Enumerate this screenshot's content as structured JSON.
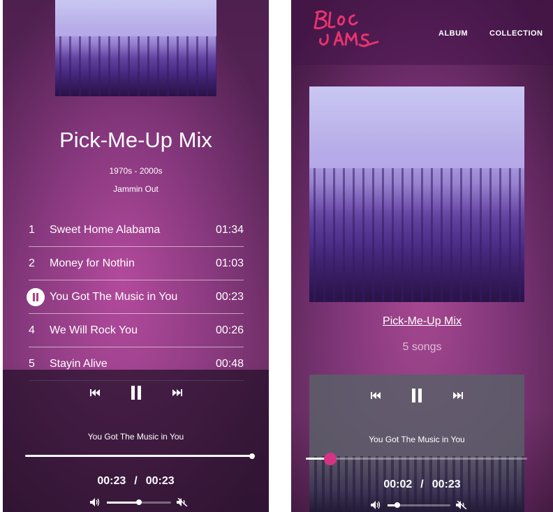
{
  "left": {
    "album": {
      "title": "Pick-Me-Up Mix",
      "years": "1970s - 2000s",
      "label": "Jammin Out"
    },
    "songs": [
      {
        "number": "1",
        "title": "Sweet Home Alabama",
        "duration": "01:34"
      },
      {
        "number": "2",
        "title": "Money for Nothin",
        "duration": "01:03"
      },
      {
        "number": "3",
        "title": "You Got The Music in You",
        "duration": "00:23",
        "playing": true
      },
      {
        "number": "4",
        "title": "We Will Rock You",
        "duration": "00:26"
      },
      {
        "number": "5",
        "title": "Stayin Alive",
        "duration": "00:48"
      }
    ],
    "player": {
      "now_playing": "You Got The Music in You",
      "current_time": "00:23",
      "separator": "/",
      "total_time": "00:23",
      "seek_progress": 1.0,
      "volume": 0.5
    }
  },
  "right": {
    "nav": {
      "logo_text": "Bloc Jams",
      "album_link": "ALBUM",
      "collection_link": "COLLECTION"
    },
    "album": {
      "title_link": "Pick-Me-Up Mix",
      "song_count": "5 songs"
    },
    "player": {
      "now_playing": "You Got The Music in You",
      "current_time": "00:02",
      "separator": "/",
      "total_time": "00:23",
      "seek_progress": 0.11,
      "volume": 0.15
    }
  },
  "icons": {
    "prev": "previous-icon",
    "pause": "pause-icon",
    "next": "next-icon",
    "volume": "volume-icon",
    "mute": "mute-icon"
  },
  "colors": {
    "accent": "#d63384",
    "logo": "#e8336f"
  }
}
